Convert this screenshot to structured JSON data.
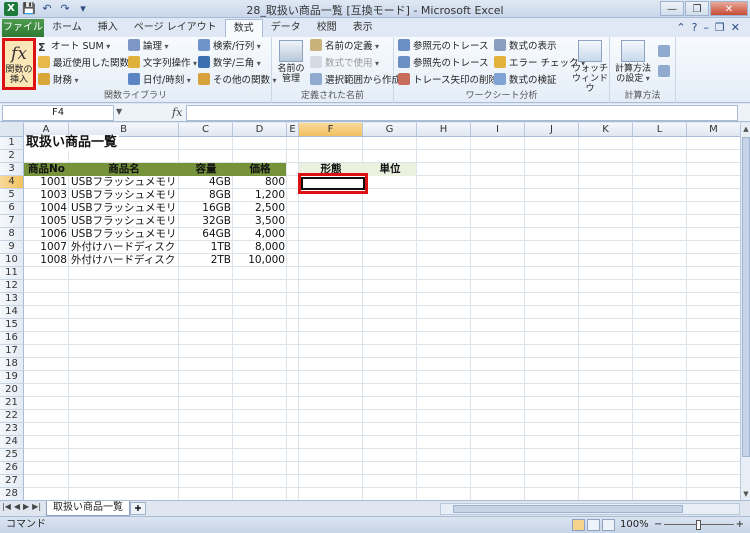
{
  "window": {
    "title": "28_取扱い商品一覧 [互換モード] - Microsoft Excel",
    "app_icon": "X"
  },
  "qat": {
    "save_icon": "💾",
    "undo_icon": "↶",
    "redo_icon": "↷",
    "customize_icon": "▾"
  },
  "window_buttons": {
    "minimize": "—",
    "restore": "❐",
    "close": "✕"
  },
  "tabs": [
    {
      "label": "ファイル"
    },
    {
      "label": "ホーム"
    },
    {
      "label": "挿入"
    },
    {
      "label": "ページ レイアウト"
    },
    {
      "label": "数式"
    },
    {
      "label": "データ"
    },
    {
      "label": "校閲"
    },
    {
      "label": "表示"
    }
  ],
  "tab_help": {
    "collapse": "⌃",
    "help": "?",
    "min": "–",
    "restore": "❐",
    "close": "✕"
  },
  "ribbon": {
    "library": {
      "label": "関数ライブラリ",
      "insert_function": {
        "icon": "fx",
        "label1": "関数の",
        "label2": "挿入"
      },
      "autosum": "オート SUM",
      "recent": "最近使用した関数",
      "financial": "財務",
      "logical": "論理",
      "text": "文字列操作",
      "datetime": "日付/時刻",
      "lookup": "検索/行列",
      "math": "数学/三角",
      "more": "その他の関数"
    },
    "names": {
      "label": "定義された名前",
      "manager1": "名前の",
      "manager2": "管理",
      "define": "名前の定義",
      "use": "数式で使用",
      "create": "選択範囲から作成"
    },
    "audit": {
      "label": "ワークシート分析",
      "precedents": "参照元のトレース",
      "dependents": "参照先のトレース",
      "remove": "トレース矢印の削除",
      "show": "数式の表示",
      "error": "エラー チェック",
      "evaluate": "数式の検証",
      "watch1": "ウォッチ",
      "watch2": "ウィンドウ"
    },
    "calc": {
      "label": "計算方法",
      "options1": "計算方法",
      "options2": "の設定"
    }
  },
  "formula_bar": {
    "name_box": "F4",
    "fx": "fx",
    "value": ""
  },
  "columns": [
    "A",
    "B",
    "C",
    "D",
    "E",
    "F",
    "G",
    "H",
    "I",
    "J",
    "K",
    "L",
    "M"
  ],
  "rows": [
    "1",
    "2",
    "3",
    "4",
    "5",
    "6",
    "7",
    "8",
    "9",
    "10",
    "11",
    "12",
    "13",
    "14",
    "15",
    "16",
    "17",
    "18",
    "19",
    "20",
    "21",
    "22",
    "23",
    "24",
    "25",
    "26",
    "27",
    "28"
  ],
  "selected_cell": {
    "col": "F",
    "row": "4"
  },
  "sheet": {
    "title": "取扱い商品一覧",
    "headers": [
      "商品No",
      "商品名",
      "容量",
      "価格"
    ],
    "side_headers": [
      "形態",
      "単位"
    ],
    "products": [
      {
        "no": "1001",
        "name": "USBフラッシュメモリ",
        "capacity": "4GB",
        "price": "800"
      },
      {
        "no": "1003",
        "name": "USBフラッシュメモリ",
        "capacity": "8GB",
        "price": "1,200"
      },
      {
        "no": "1004",
        "name": "USBフラッシュメモリ",
        "capacity": "16GB",
        "price": "2,500"
      },
      {
        "no": "1005",
        "name": "USBフラッシュメモリ",
        "capacity": "32GB",
        "price": "3,500"
      },
      {
        "no": "1006",
        "name": "USBフラッシュメモリ",
        "capacity": "64GB",
        "price": "4,000"
      },
      {
        "no": "1007",
        "name": "外付けハードディスク",
        "capacity": "1TB",
        "price": "8,000"
      },
      {
        "no": "1008",
        "name": "外付けハードディスク",
        "capacity": "2TB",
        "price": "10,000"
      }
    ],
    "colors": {
      "header_fill": "#76933c",
      "side_header_fill": "#ebf1de",
      "highlight": "#dd1111"
    }
  },
  "sheet_tabs": {
    "nav": [
      "|◀",
      "◀",
      "▶",
      "▶|"
    ],
    "active": "取扱い商品一覧",
    "new_sheet_icon": "✚"
  },
  "status": {
    "mode": "コマンド",
    "zoom": "100%",
    "zoom_minus": "−",
    "zoom_plus": "+"
  }
}
